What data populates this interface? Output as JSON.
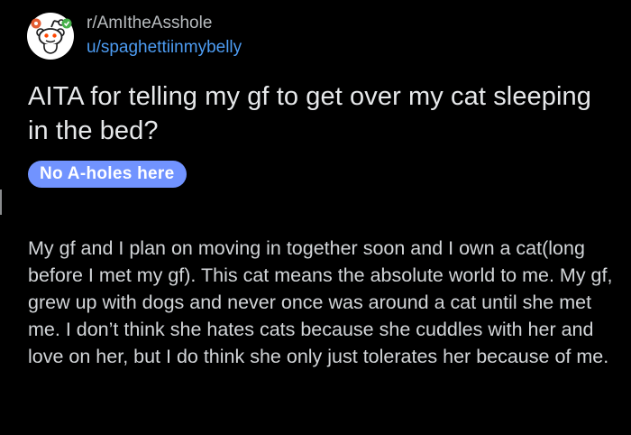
{
  "post": {
    "subreddit": "r/AmItheAsshole",
    "username": "u/spaghettiinmybelly",
    "title": "AITA for telling my gf to get over my cat sleeping in the bed?",
    "flair": "No A-holes here",
    "body": "My gf and I plan on moving in together soon and I own a cat(long before I met my gf). This cat means the absolute world to me. My gf, grew up with dogs and never once was around a cat until she met me. I don’t think she hates cats because she cuddles with her and love on her, but I do think she only just tolerates her because of me."
  },
  "colors": {
    "background": "#000000",
    "username": "#4d9cf2",
    "flair_background": "#7193ff"
  },
  "icons": {
    "avatar": "reddit-snoo-icon"
  }
}
